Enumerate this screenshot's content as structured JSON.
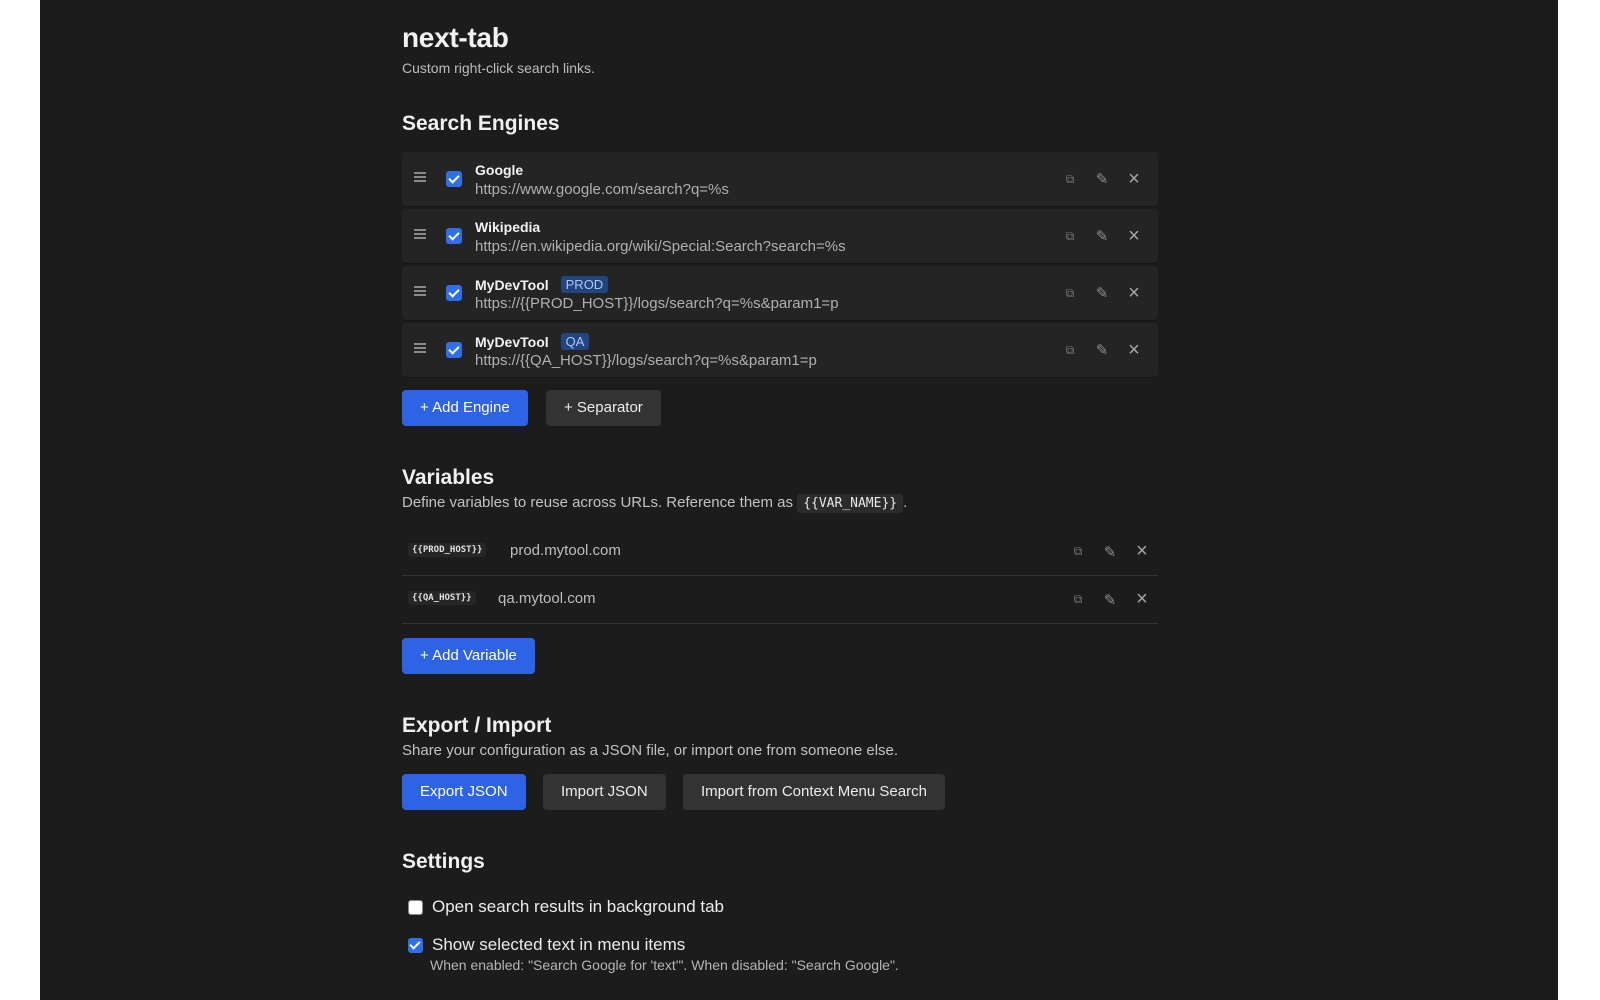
{
  "app": {
    "title": "next-tab",
    "subtitle": "Custom right-click search links."
  },
  "search_engines": {
    "title": "Search Engines",
    "items": [
      {
        "name": "Google",
        "badge": "",
        "url": "https://www.google.com/search?q=%s",
        "enabled": true
      },
      {
        "name": "Wikipedia",
        "badge": "",
        "url": "https://en.wikipedia.org/wiki/Special:Search?search=%s",
        "enabled": true
      },
      {
        "name": "MyDevTool",
        "badge": "PROD",
        "url": "https://{{PROD_HOST}}/logs/search?q=%s&param1=p",
        "enabled": true
      },
      {
        "name": "MyDevTool",
        "badge": "QA",
        "url": "https://{{QA_HOST}}/logs/search?q=%s&param1=p",
        "enabled": true
      }
    ],
    "add_engine_label": "+ Add Engine",
    "add_separator_label": "+ Separator"
  },
  "variables": {
    "title": "Variables",
    "desc_before": "Define variables to reuse across URLs. Reference them as ",
    "desc_code": "{{VAR_NAME}}",
    "desc_after": ".",
    "items": [
      {
        "key": "{{PROD_HOST}}",
        "value": "prod.mytool.com"
      },
      {
        "key": "{{QA_HOST}}",
        "value": "qa.mytool.com"
      }
    ],
    "add_variable_label": "+ Add Variable"
  },
  "export_import": {
    "title": "Export / Import",
    "desc": "Share your configuration as a JSON file, or import one from someone else.",
    "export_label": "Export JSON",
    "import_label": "Import JSON",
    "import_context_label": "Import from Context Menu Search"
  },
  "settings": {
    "title": "Settings",
    "background_tab": {
      "label": "Open search results in background tab",
      "checked": false
    },
    "show_selected": {
      "label": "Show selected text in menu items",
      "checked": true,
      "help": "When enabled: \"Search Google for 'text'\". When disabled: \"Search Google\"."
    }
  },
  "icons": {
    "drag": "drag-handle-icon",
    "copy": "copy-icon",
    "edit": "pencil-icon",
    "delete": "close-icon"
  },
  "colors": {
    "background": "#1c1c1c",
    "accent": "#2f63e6",
    "badge_bg": "#23457e",
    "badge_text": "#a9c6ff"
  }
}
